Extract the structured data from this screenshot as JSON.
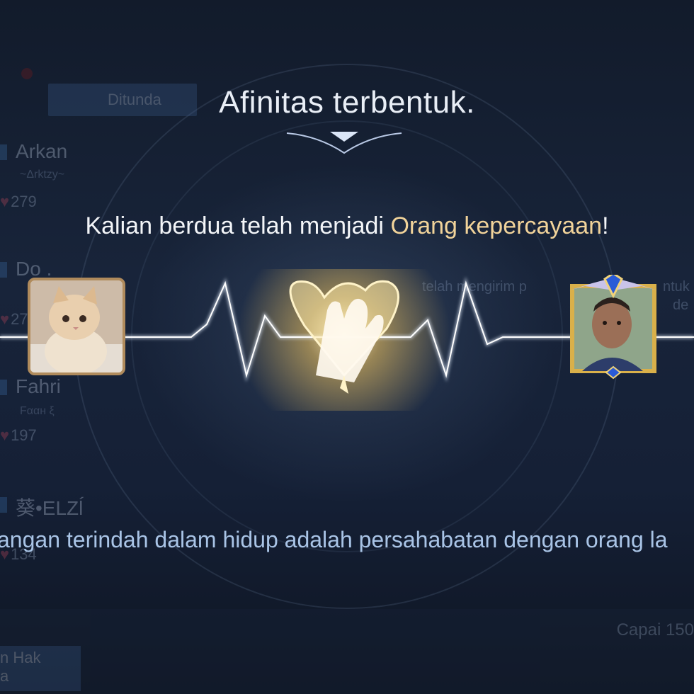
{
  "background": {
    "tab_label": "Ditunda",
    "friends": [
      {
        "name": "Arkan",
        "sub": "~Δrktzy~",
        "count": "279"
      },
      {
        "name": "Do .",
        "sub": "",
        "count": "27"
      },
      {
        "name": "Fahri",
        "sub": "Fααн ξ",
        "count": "197"
      },
      {
        "name": "葵•ELZĺ",
        "sub": "",
        "count": "134"
      }
    ],
    "side_text_1": "telah mengirim p",
    "side_text_2": "ntuk",
    "side_text_3": "de",
    "reach_label": "Capai 150",
    "bottom_button": "n Hak\na"
  },
  "overlay": {
    "title": "Afinitas terbentuk.",
    "headline_prefix": "Kalian berdua telah menjadi ",
    "headline_highlight": "Orang kepercayaan",
    "headline_suffix": "!",
    "quote": "angan terindah dalam hidup adalah persahabatan dengan orang la"
  },
  "icons": {
    "center": "high-five-hands-icon",
    "left_avatar": "cat-avatar",
    "right_avatar": "player-avatar-with-rank-frame"
  },
  "colors": {
    "gold": "#f1d39a",
    "quote_blue": "#a9c4e6",
    "frame_gold": "#d9b04a"
  }
}
